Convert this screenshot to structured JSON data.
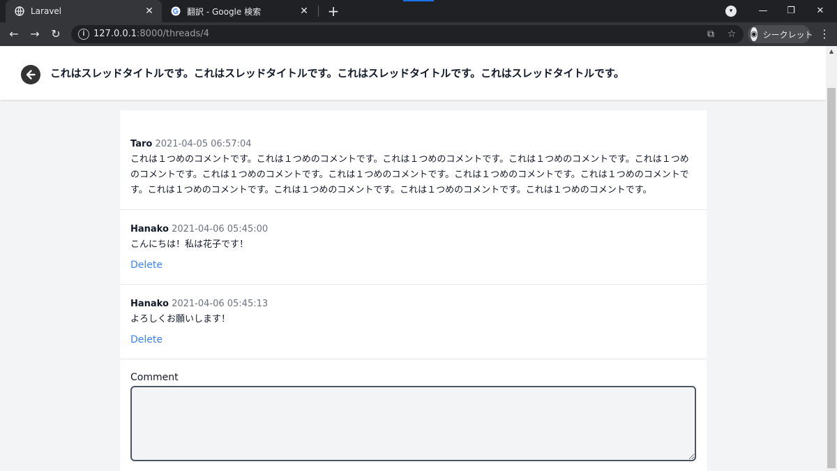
{
  "browser": {
    "tabs": [
      {
        "title": "Laravel",
        "active": true,
        "favicon": "globe-icon"
      },
      {
        "title": "翻訳 - Google 検索",
        "active": false,
        "favicon": "google-g-icon"
      }
    ],
    "url_host": "127.0.0.1",
    "url_rest": ":8000/threads/4",
    "profile_label": "シークレット"
  },
  "thread": {
    "title": "これはスレッドタイトルです。これはスレッドタイトルです。これはスレッドタイトルです。これはスレッドタイトルです。"
  },
  "comments": [
    {
      "author": "Taro",
      "date": "2021-04-05 06:57:04",
      "body": "これは１つめのコメントです。これは１つめのコメントです。これは１つめのコメントです。これは１つめのコメントです。これは１つめのコメントです。これは１つめのコメントです。これは１つめのコメントです。これは１つめのコメントです。これは１つめのコメントです。これは１つめのコメントです。これは１つめのコメントです。これは１つめのコメントです。これは１つめのコメントです。"
    },
    {
      "author": "Hanako",
      "date": "2021-04-06 05:45:00",
      "body": "こんにちは！私は花子です！",
      "delete_label": "Delete"
    },
    {
      "author": "Hanako",
      "date": "2021-04-06 05:45:13",
      "body": "よろしくお願いします！",
      "delete_label": "Delete"
    }
  ],
  "form": {
    "label": "Comment",
    "value": ""
  },
  "colors": {
    "link": "#3b82f6",
    "page_bg": "#f3f4f6",
    "chrome_dark": "#202124"
  }
}
